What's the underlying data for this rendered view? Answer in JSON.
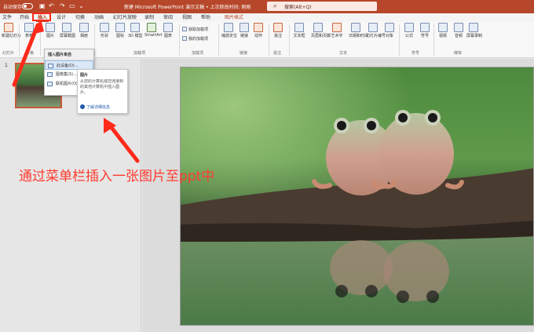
{
  "titlebar": {
    "autosave_label": "自动保存",
    "toggle_state": "关",
    "document_title": "新建 Microsoft PowerPoint 演示文稿 • 上次修改时间: 刚刚",
    "search_placeholder": "搜索(Alt+Q)"
  },
  "menu": {
    "tabs": [
      "文件",
      "开始",
      "插入",
      "设计",
      "切换",
      "动画",
      "幻灯片放映",
      "录制",
      "审阅",
      "视图",
      "帮助"
    ],
    "active_tab": "插入",
    "context_tab": "图片格式"
  },
  "ribbon": {
    "buttons": [
      {
        "label": "新建幻灯片",
        "group": "幻灯片"
      },
      {
        "label": "表格",
        "group": "表格"
      },
      {
        "label": "图片",
        "group": "图像"
      },
      {
        "label": "屏幕截图",
        "group": "图像"
      },
      {
        "label": "相册",
        "group": "图像"
      },
      {
        "label": "形状",
        "group": "插图"
      },
      {
        "label": "图标",
        "group": "插图"
      },
      {
        "label": "3D 模型",
        "group": "插图"
      },
      {
        "label": "SmartArt",
        "group": "插图"
      },
      {
        "label": "图表",
        "group": "插图"
      },
      {
        "label": "缩放定位",
        "group": "链接"
      },
      {
        "label": "链接",
        "group": "链接"
      },
      {
        "label": "动作",
        "group": "链接"
      },
      {
        "label": "批注",
        "group": "批注"
      },
      {
        "label": "文本框",
        "group": "文本"
      },
      {
        "label": "页眉和页脚",
        "group": "文本"
      },
      {
        "label": "艺术字",
        "group": "文本"
      },
      {
        "label": "日期和时间",
        "group": "文本"
      },
      {
        "label": "幻灯片编号",
        "group": "文本"
      },
      {
        "label": "对象",
        "group": "文本"
      },
      {
        "label": "公式",
        "group": "符号"
      },
      {
        "label": "符号",
        "group": "符号"
      },
      {
        "label": "视频",
        "group": "媒体"
      },
      {
        "label": "音频",
        "group": "媒体"
      },
      {
        "label": "屏幕录制",
        "group": "媒体"
      }
    ],
    "addins": [
      "获取加载项",
      "我的加载项"
    ],
    "group_labels": [
      "幻灯片",
      "表格",
      "图像",
      "加载项",
      "链接",
      "批注",
      "文本",
      "符号",
      "媒体"
    ]
  },
  "dropdown": {
    "header": "插入图片来自",
    "items": [
      "此设备(D)...",
      "图像集(S)...",
      "联机图片(O)..."
    ]
  },
  "tooltip": {
    "title": "图片",
    "description": "从您的计算机或您连接到的其他计算机中插入图片。",
    "link": "了解详细信息"
  },
  "slides_pane": {
    "slide_number": "1"
  },
  "annotation": {
    "text": "通过菜单栏插入一张图片至ppt中"
  },
  "colors": {
    "accent": "#b7472a",
    "annotation": "#ff3b2f"
  }
}
